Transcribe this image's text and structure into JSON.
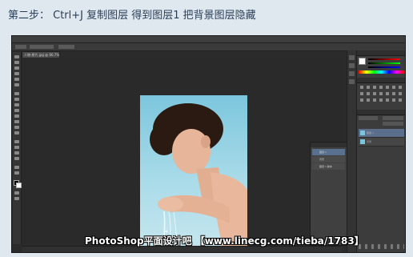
{
  "caption": "第二步： Ctrl+J 复制图层 得到图层1 把背景图层隐藏",
  "photoshop": {
    "document_tab": "人物-原片.jpg @ 66.7%(图层 1, RGB/8)",
    "layers_floating": [
      "图层 1",
      "背景",
      "图层 1 副本"
    ],
    "layers_panel": [
      "图层 1",
      "背景"
    ]
  },
  "watermark": "PhotoShop平面设计吧 【www.linecg.com/tieba/1783】",
  "colors": {
    "page_bg": "#dfe8ef",
    "caption_text": "#2a3e57",
    "ps_dark": "#2b2b2b",
    "selected_layer": "#5b6f8c"
  }
}
